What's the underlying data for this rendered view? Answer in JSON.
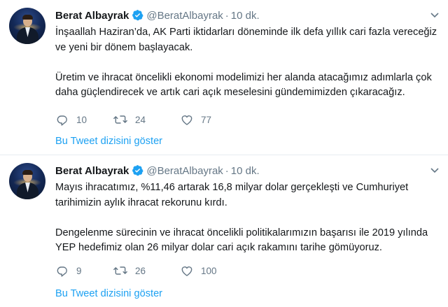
{
  "tweets": [
    {
      "author_name": "Berat Albayrak",
      "handle": "@BeratAlbayrak",
      "separator": "·",
      "time": "10 dk.",
      "paragraphs": [
        "İnşaallah Haziran’da, AK Parti iktidarları döneminde ilk defa yıllık cari fazla vereceğiz ve yeni bir dönem başlayacak.",
        "Üretim ve ihracat öncelikli ekonomi modelimizi her alanda atacağımız adımlarla çok daha güçlendirecek ve artık cari açık meselesini gündemimizden çıkaracağız."
      ],
      "replies": "10",
      "retweets": "24",
      "likes": "77",
      "thread_link": "Bu Tweet dizisini göster"
    },
    {
      "author_name": "Berat Albayrak",
      "handle": "@BeratAlbayrak",
      "separator": "·",
      "time": "10 dk.",
      "paragraphs": [
        "Mayıs ihracatımız, %11,46 artarak 16,8 milyar dolar gerçekleşti ve Cumhuriyet tarihimizin aylık ihracat rekorunu kırdı.",
        "Dengelenme sürecinin ve ihracat öncelikli politikalarımızın başarısı ile 2019 yılında YEP hedefimiz olan 26 milyar dolar cari açık rakamını tarihe gömüyoruz."
      ],
      "replies": "9",
      "retweets": "26",
      "likes": "100",
      "thread_link": "Bu Tweet dizisini göster"
    }
  ],
  "colors": {
    "accent": "#1da1f2",
    "secondary_text": "#657786",
    "primary_text": "#14171a",
    "divider": "#e6ecf0"
  },
  "icons": {
    "verified": "verified-badge-icon",
    "caret": "chevron-down-icon",
    "reply": "reply-bubble-icon",
    "retweet": "retweet-icon",
    "like": "heart-icon",
    "dm": "envelope-icon"
  }
}
